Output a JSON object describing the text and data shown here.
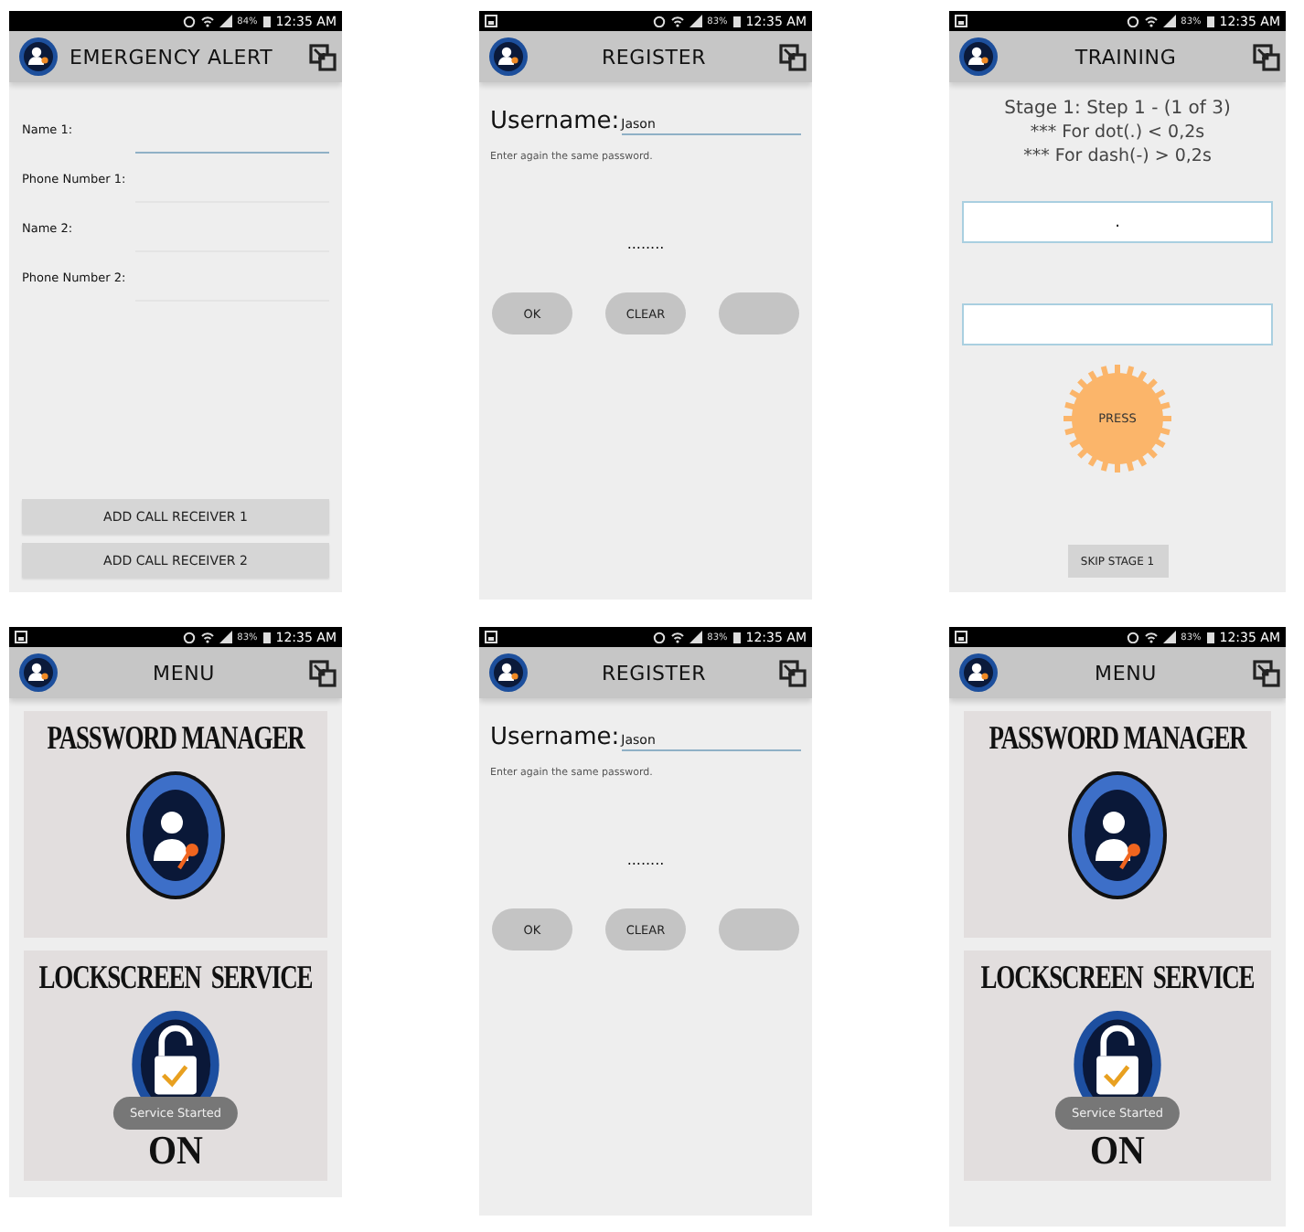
{
  "screens": [
    {
      "kind": "form",
      "status_bar": {
        "notification": false,
        "battery": "84%",
        "time": "12:35 AM"
      },
      "title": "EMERGENCY ALERT",
      "fields": [
        {
          "label": "Name 1:",
          "focused": true
        },
        {
          "label": "Phone Number 1:",
          "focused": false
        },
        {
          "label": "Name 2:",
          "focused": false
        },
        {
          "label": "Phone Number 2:",
          "focused": false
        }
      ],
      "buttons": [
        "ADD CALL RECEIVER 1",
        "ADD CALL RECEIVER 2"
      ]
    },
    {
      "kind": "register",
      "status_bar": {
        "notification": true,
        "battery": "83%",
        "time": "12:35 AM"
      },
      "title": "REGISTER",
      "username_label": "Username:",
      "username_value": "Jason",
      "hint": "Enter again the same password.",
      "password": "........",
      "buttons": [
        {
          "kind": "text",
          "label": "OK"
        },
        {
          "kind": "text",
          "label": "CLEAR"
        },
        {
          "kind": "blank"
        }
      ]
    },
    {
      "kind": "training",
      "status_bar": {
        "notification": true,
        "battery": "83%",
        "time": "12:35 AM"
      },
      "title": "TRAINING",
      "instructions": [
        "Stage 1: Step 1 - (1 of 3)",
        "*** For dot(.) < 0,2s",
        "*** For dash(-) > 0,2s"
      ],
      "inputs": [
        "."
      ],
      "press_label": "PRESS",
      "skip_label": "SKIP STAGE 1"
    },
    {
      "kind": "menu",
      "status_bar": {
        "notification": true,
        "battery": "83%",
        "time": "12:35 AM"
      },
      "title": "MENU",
      "cards": [
        {
          "title": "PASSWORD MANAGER"
        },
        {
          "title": "LOCKSCREEN  SERVICE",
          "state": "ON"
        }
      ],
      "toast": "Service Started"
    },
    {
      "kind": "register",
      "status_bar": {
        "notification": true,
        "battery": "83%",
        "time": "12:35 AM"
      },
      "title": "REGISTER",
      "username_label": "Username:",
      "username_value": "Jason",
      "hint": "Enter again the same password.",
      "password": "........",
      "buttons": [
        {
          "kind": "text",
          "label": "OK"
        },
        {
          "kind": "text",
          "label": "CLEAR"
        },
        {
          "kind": "blank"
        }
      ]
    },
    {
      "kind": "menu",
      "status_bar": {
        "notification": true,
        "battery": "83%",
        "time": "12:35 AM"
      },
      "title": "MENU",
      "cards": [
        {
          "title": "PASSWORD MANAGER"
        },
        {
          "title": "LOCKSCREEN  SERVICE",
          "state": "ON"
        }
      ],
      "toast": "Service Started"
    }
  ]
}
